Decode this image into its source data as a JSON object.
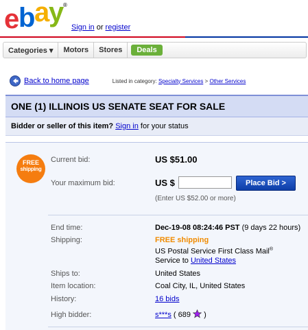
{
  "header": {
    "logo": {
      "letters": [
        "e",
        "b",
        "a",
        "y"
      ],
      "colors": [
        "#e53238",
        "#0064d2",
        "#f5af02",
        "#86b817"
      ],
      "registered": "®"
    },
    "sign_in": "Sign in",
    "or": " or ",
    "register": "register"
  },
  "nav": {
    "items": [
      {
        "label": "Categories ▾",
        "name": "nav-categories"
      },
      {
        "label": "Motors",
        "name": "nav-motors"
      },
      {
        "label": "Stores",
        "name": "nav-stores"
      }
    ],
    "deals": "Deals"
  },
  "breadcrumb": {
    "back_label": "Back to home page",
    "listed_prefix": "Listed in category: ",
    "category1": "Specialty Services",
    "separator": " > ",
    "category2": "Other Services"
  },
  "item": {
    "title": "ONE (1) ILLINOIS US SENATE SEAT FOR SALE"
  },
  "status": {
    "prefix": "Bidder or seller of this item?",
    "sign_in": "Sign in",
    "suffix": " for your status"
  },
  "badge": {
    "line1": "FREE",
    "line2": "shipping"
  },
  "bid": {
    "current_label": "Current bid:",
    "current_value": "US $51.00",
    "max_label": "Your maximum bid:",
    "currency": "US $",
    "input_value": "",
    "button": "Place Bid >",
    "hint": "(Enter US $52.00 or more)"
  },
  "details": {
    "end_label": "End time:",
    "end_value": "Dec-19-08 08:24:46 PST",
    "end_remaining": " (9 days 22 hours)",
    "shipping_label": "Shipping:",
    "shipping_free": "FREE shipping",
    "shipping_service": "US Postal Service First Class Mail",
    "shipping_reg": "®",
    "shipping_to_prefix": "Service to ",
    "shipping_to_link": "United States",
    "ships_to_label": "Ships to:",
    "ships_to_value": "United States",
    "location_label": "Item location:",
    "location_value": "Coal City, IL, United States",
    "history_label": "History:",
    "history_value": "16 bids",
    "high_bidder_label": "High bidder:",
    "high_bidder_name": "s***s",
    "high_bidder_score_open": " ( 689 ",
    "high_bidder_score_close": " )",
    "star_color": "#a020f0"
  }
}
